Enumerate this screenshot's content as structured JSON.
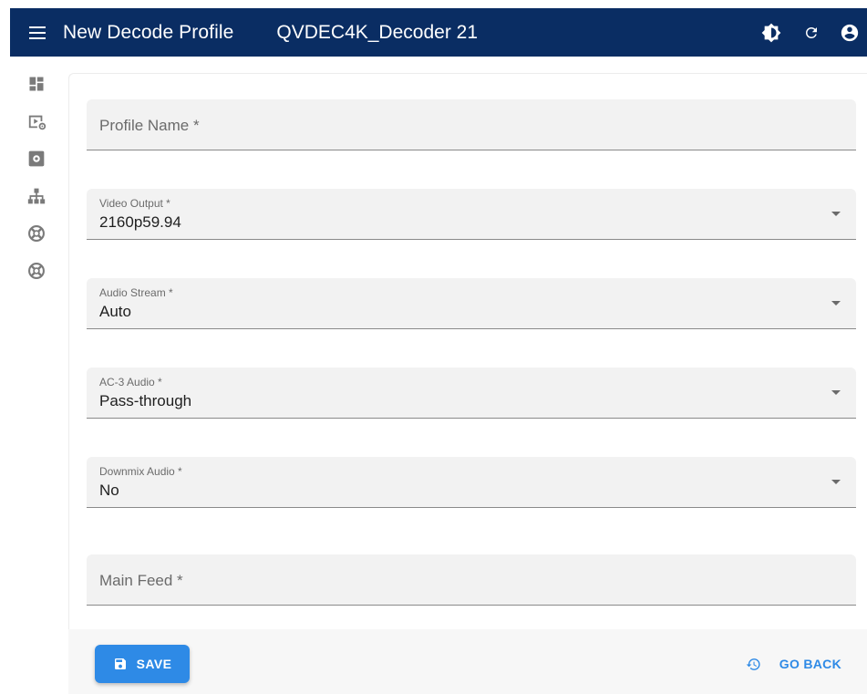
{
  "appbar": {
    "title": "New Decode Profile",
    "device": "QVDEC4K_Decoder 21",
    "icons": [
      "menu-icon",
      "theme-icon",
      "refresh-icon",
      "account-icon"
    ],
    "background": "#0a2d63"
  },
  "rail": {
    "icons": [
      "dashboard-icon",
      "video-settings-icon",
      "settings-box-icon",
      "network-icon",
      "support-icon",
      "support-icon"
    ]
  },
  "form": {
    "profile_name": {
      "placeholder": "Profile Name *"
    },
    "video_output": {
      "label": "Video Output *",
      "value": "2160p59.94"
    },
    "audio_stream": {
      "label": "Audio Stream *",
      "value": "Auto"
    },
    "ac3_audio": {
      "label": "AC-3 Audio *",
      "value": "Pass-through"
    },
    "downmix_audio": {
      "label": "Downmix Audio *",
      "value": "No"
    },
    "main_feed": {
      "placeholder": "Main Feed *"
    }
  },
  "footer": {
    "save_label": "SAVE",
    "go_back_label": "GO BACK",
    "accent": "#2e8ae6"
  }
}
